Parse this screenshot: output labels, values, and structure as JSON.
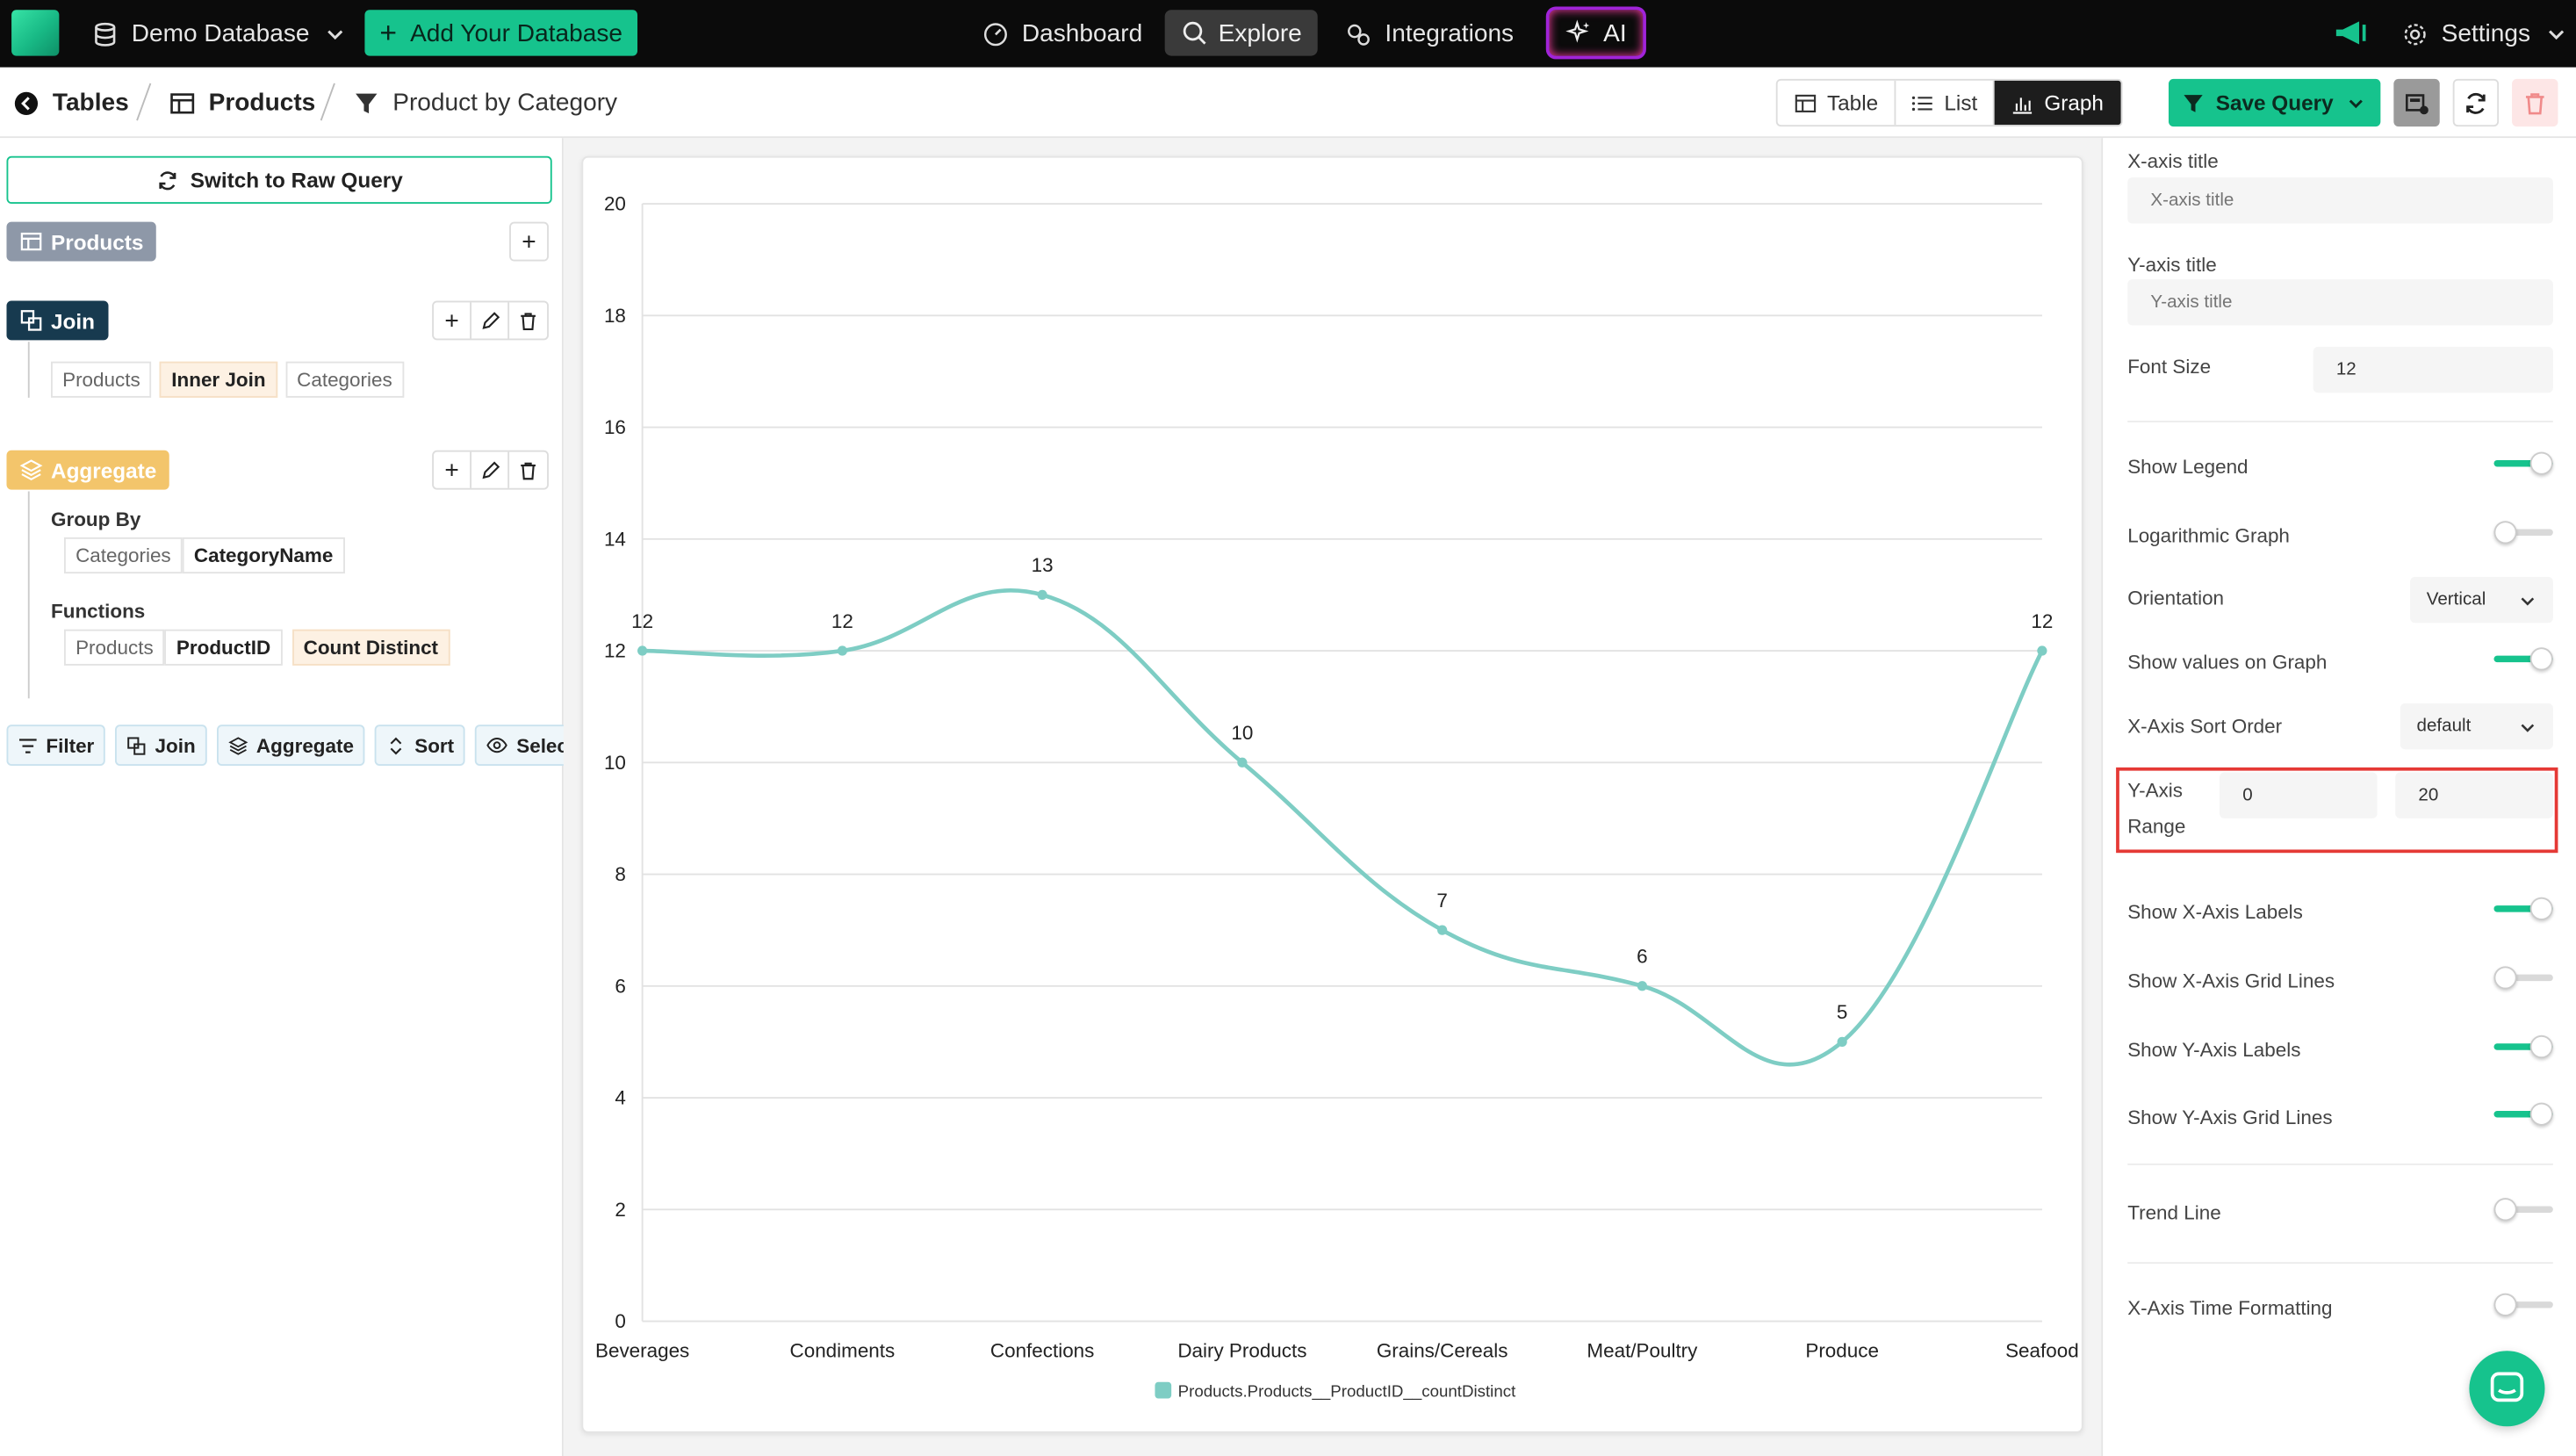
{
  "topbar": {
    "database": "Demo Database",
    "add_database": "Add Your Database",
    "nav": [
      "Dashboard",
      "Explore",
      "Integrations",
      "AI"
    ],
    "settings": "Settings"
  },
  "breadcrumb": {
    "tables": "Tables",
    "products": "Products",
    "query": "Product by Category"
  },
  "view_modes": [
    "Table",
    "List",
    "Graph"
  ],
  "save_query": "Save Query",
  "left": {
    "raw_query": "Switch to Raw Query",
    "source": "Products",
    "join": {
      "label": "Join",
      "left": "Products",
      "type": "Inner Join",
      "right": "Categories"
    },
    "aggregate": {
      "label": "Aggregate",
      "group_by_label": "Group By",
      "group_table": "Categories",
      "group_field": "CategoryName",
      "functions_label": "Functions",
      "func_table": "Products",
      "func_field": "ProductID",
      "func_name": "Count Distinct"
    },
    "tools": [
      "Filter",
      "Join",
      "Aggregate",
      "Sort",
      "Select"
    ]
  },
  "chart_data": {
    "type": "line",
    "categories": [
      "Beverages",
      "Condiments",
      "Confections",
      "Dairy Products",
      "Grains/Cereals",
      "Meat/Poultry",
      "Produce",
      "Seafood"
    ],
    "series": [
      {
        "name": "Products.Products__ProductID__countDistinct",
        "values": [
          12,
          12,
          13,
          10,
          7,
          6,
          5,
          12
        ]
      }
    ],
    "ylim": [
      0,
      20
    ],
    "yticks": [
      0,
      2,
      4,
      6,
      8,
      10,
      12,
      14,
      16,
      18,
      20
    ],
    "grid": true,
    "legend": "bottom-center",
    "color": "#7ecdc4"
  },
  "right": {
    "x_title_label": "X-axis title",
    "x_title_placeholder": "X-axis title",
    "y_title_label": "Y-axis title",
    "y_title_placeholder": "Y-axis title",
    "font_size_label": "Font Size",
    "font_size": "12",
    "show_legend": "Show Legend",
    "log_graph": "Logarithmic Graph",
    "orientation_label": "Orientation",
    "orientation": "Vertical",
    "show_values": "Show values on Graph",
    "sort_label": "X-Axis Sort Order",
    "sort": "default",
    "y_range_label_1": "Y-Axis",
    "y_range_label_2": "Range",
    "y_min": "0",
    "y_max": "20",
    "show_x_labels": "Show X-Axis Labels",
    "show_x_grid": "Show X-Axis Grid Lines",
    "show_y_labels": "Show Y-Axis Labels",
    "show_y_grid": "Show Y-Axis Grid Lines",
    "trend_line": "Trend Line",
    "time_format": "X-Axis Time Formatting"
  }
}
